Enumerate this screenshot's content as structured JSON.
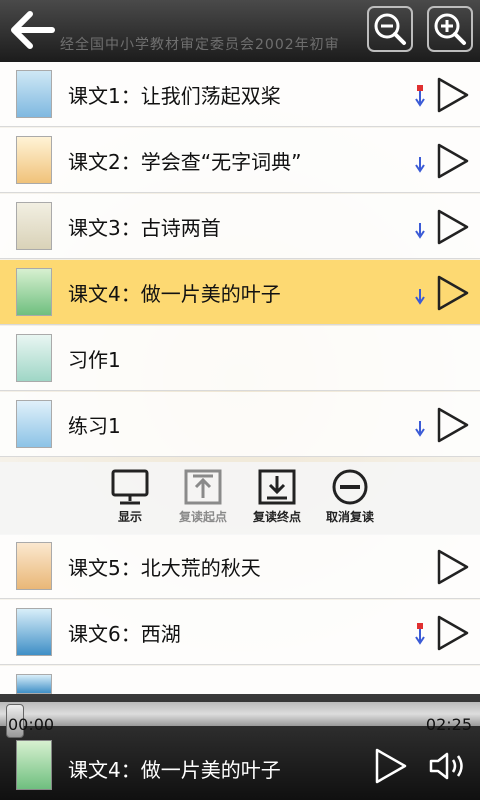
{
  "header": {
    "watermark": "经全国中小学教材审定委员会2002年初审",
    "back_icon": "back-arrow-icon",
    "zoom_out_icon": "zoom-out-icon",
    "zoom_in_icon": "zoom-in-icon"
  },
  "lessons": [
    {
      "title": "课文1：让我们荡起双桨",
      "download": true,
      "play": true
    },
    {
      "title": "课文2：学会查“无字词典”",
      "download": true,
      "play": true
    },
    {
      "title": "课文3：古诗两首",
      "download": true,
      "play": true
    },
    {
      "title": "课文4：做一片美的叶子",
      "download": true,
      "play": true,
      "active": true
    },
    {
      "title": "习作1",
      "download": false,
      "play": false
    },
    {
      "title": "练习1",
      "download": true,
      "play": true
    },
    {
      "title": "课文5：北大荒的秋天",
      "download": false,
      "play": true
    },
    {
      "title": "课文6：西湖",
      "download": true,
      "play": true
    }
  ],
  "toolbar": {
    "display": "显示",
    "repeat_start": "复读起点",
    "repeat_end": "复读终点",
    "cancel_repeat": "取消复读"
  },
  "player": {
    "current_time": "00:00",
    "total_time": "02:25",
    "progress": 0,
    "now_playing": "课文4：做一片美的叶子"
  },
  "colors": {
    "active_row": "#fdd972",
    "download_arrow": "#3b5bd6",
    "download_red": "#e03030"
  }
}
